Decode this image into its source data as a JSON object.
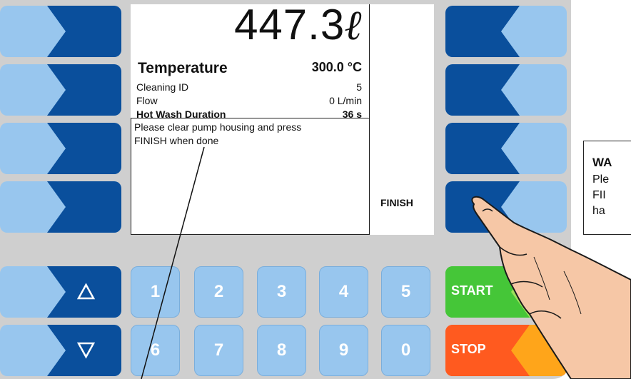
{
  "display": {
    "volume_value": "447.3",
    "volume_unit": "ℓ",
    "temperature_label": "Temperature",
    "temperature_value": "300.0 °C",
    "rows": [
      {
        "label": "Cleaning ID",
        "value": "5"
      },
      {
        "label": "Flow",
        "value": "0 L/min"
      },
      {
        "label": "Hot Wash Duration",
        "value": "36 s"
      }
    ],
    "message_line1": "Please clear pump housing and press",
    "message_line2": "FINISH when done",
    "softkey_finish_label": "FINISH"
  },
  "keypad": {
    "up_icon": "up-triangle-icon",
    "down_icon": "down-triangle-icon",
    "row1": [
      "1",
      "2",
      "3",
      "4",
      "5"
    ],
    "row2": [
      "6",
      "7",
      "8",
      "9",
      "0"
    ],
    "start_label": "START",
    "stop_label": "STOP"
  },
  "warning": {
    "title": "WA",
    "text": "Ple\nFII\nha"
  },
  "colors": {
    "panel": "#cfcfcf",
    "softkey_light": "#98c6ee",
    "softkey_dark": "#0a4f9c",
    "start": "#45c638",
    "stop": "#ff5a1f",
    "stop_accent": "#ffa51a"
  }
}
